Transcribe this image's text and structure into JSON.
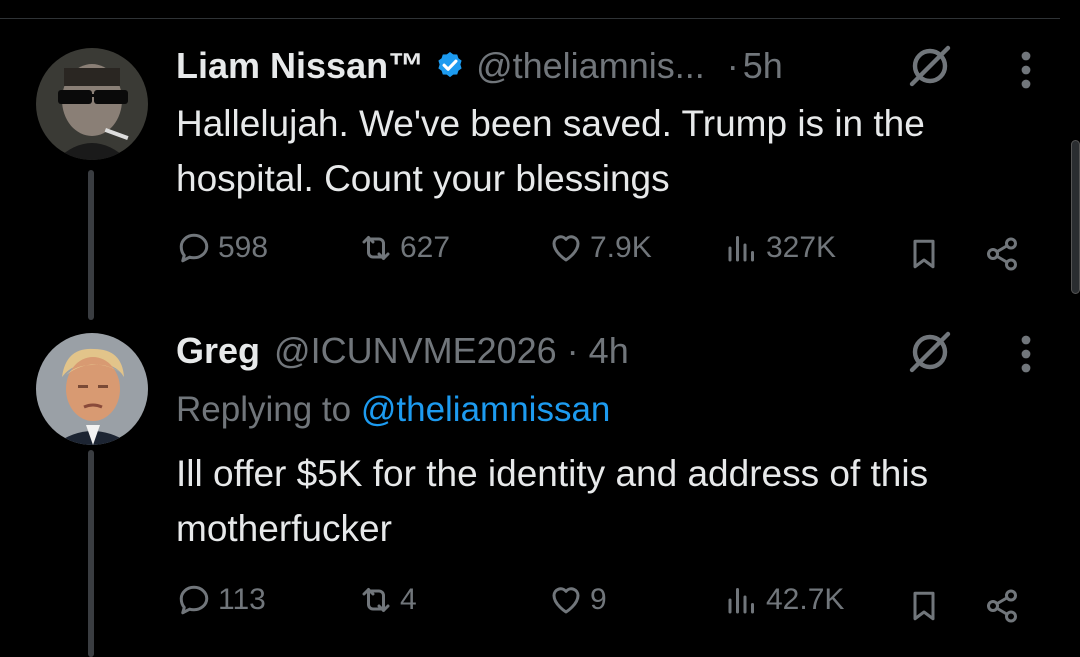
{
  "tweets": [
    {
      "name": "Liam Nissan™",
      "verified": true,
      "handle": "@theliamnis...",
      "separator": "·",
      "time": "5h",
      "text": "Hallelujah. We've been saved. Trump is in the hospital. Count your blessings",
      "stats": {
        "replies": "598",
        "reposts": "627",
        "likes": "7.9K",
        "views": "327K"
      }
    },
    {
      "name": "Greg",
      "verified": false,
      "handle": "@ICUNVME2026",
      "separator": "·",
      "time": "4h",
      "reply_prefix": "Replying to",
      "reply_to": "@theliamnissan",
      "text": "Ill offer $5K for the identity and address of this motherfucker",
      "stats": {
        "replies": "113",
        "reposts": "4",
        "likes": "9",
        "views": "42.7K"
      }
    }
  ],
  "icons": [
    "grok-icon",
    "more-options-icon",
    "reply-icon",
    "repost-icon",
    "like-icon",
    "views-icon",
    "bookmark-icon",
    "share-icon",
    "verified-badge-icon"
  ],
  "colors": {
    "background": "#000000",
    "text": "#e7e9ea",
    "muted": "#71767b",
    "link": "#1d9bf0",
    "verified": "#1d9bf0"
  }
}
